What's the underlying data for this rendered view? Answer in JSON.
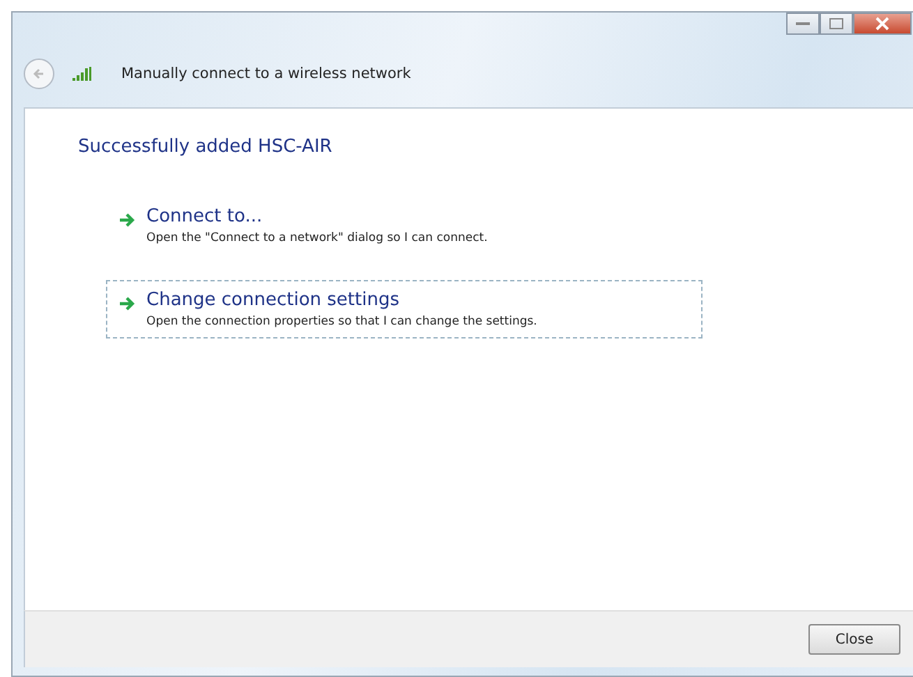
{
  "window": {
    "title": "Manually connect to a wireless network"
  },
  "heading": "Successfully added HSC-AIR",
  "options": [
    {
      "title": "Connect to...",
      "description": "Open the \"Connect to a network\" dialog so I can connect.",
      "focused": false
    },
    {
      "title": "Change connection settings",
      "description": "Open the connection properties so that I can change the settings.",
      "focused": true
    }
  ],
  "buttons": [
    "Close"
  ]
}
